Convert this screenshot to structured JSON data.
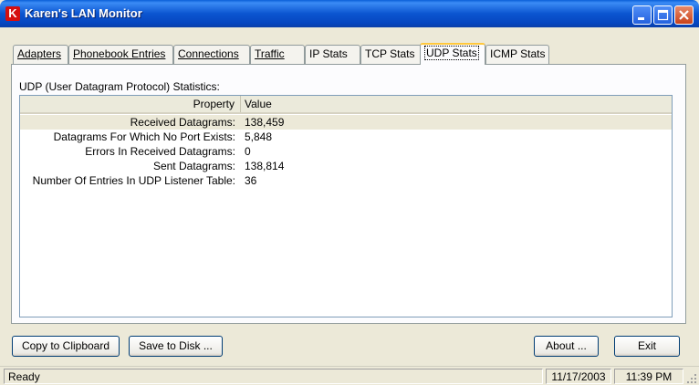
{
  "window": {
    "title": "Karen's LAN Monitor",
    "icon_letter": "K"
  },
  "tabs": [
    {
      "label": "Adapters"
    },
    {
      "label": "Phonebook Entries"
    },
    {
      "label": "Connections"
    },
    {
      "label": "Traffic"
    },
    {
      "label": "IP Stats"
    },
    {
      "label": "TCP Stats"
    },
    {
      "label": "UDP Stats"
    },
    {
      "label": "ICMP Stats"
    }
  ],
  "section_label": "UDP (User Datagram Protocol) Statistics:",
  "table": {
    "columns": {
      "property": "Property",
      "value": "Value"
    },
    "rows": [
      {
        "property": "Received Datagrams:",
        "value": "138,459"
      },
      {
        "property": "Datagrams For Which No Port Exists:",
        "value": "5,848"
      },
      {
        "property": "Errors In Received Datagrams:",
        "value": "0"
      },
      {
        "property": "Sent Datagrams:",
        "value": "138,814"
      },
      {
        "property": "Number Of Entries In UDP Listener Table:",
        "value": "36"
      }
    ]
  },
  "buttons": {
    "copy": "Copy to Clipboard",
    "save": "Save to Disk ...",
    "about": "About ...",
    "exit": "Exit"
  },
  "status": {
    "text": "Ready",
    "date": "11/17/2003",
    "time": "11:39 PM"
  }
}
